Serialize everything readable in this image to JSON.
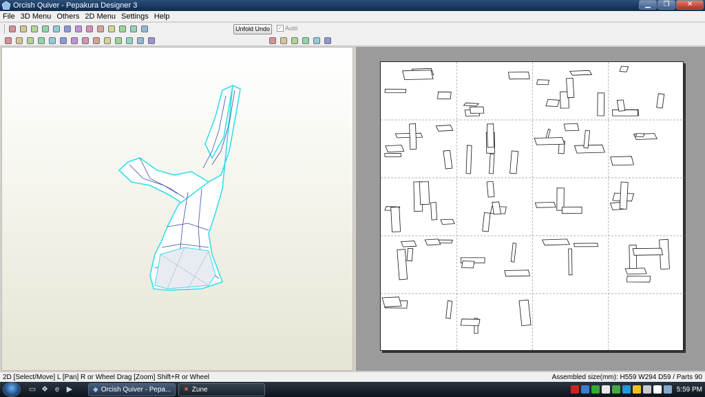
{
  "window": {
    "title": "Orcish Quiver - Pepakura Designer 3"
  },
  "window_controls": {
    "minimize": "▁",
    "maximize": "❐",
    "close": "✕"
  },
  "menu": [
    "File",
    "3D Menu",
    "Others",
    "2D Menu",
    "Settings",
    "Help"
  ],
  "toolbar": {
    "undo_label": "Unfold Undo",
    "auto_label": "Auto",
    "auto_checked": true
  },
  "toolbar1_icons": [
    "open-folder-icon",
    "save-icon",
    "bulb-icon",
    "cube-color-icon",
    "rotate-icon",
    "move-icon",
    "pencil-icon",
    "cylinder-icon",
    "anchor-icon",
    "page-icon",
    "globe-icon",
    "window-icon",
    "window2-icon"
  ],
  "toolbar2_icons": [
    "select-icon",
    "pen-icon",
    "part-icon",
    "flip-icon",
    "flap-icon",
    "edge-icon",
    "fill-icon",
    "paint-icon",
    "back-icon",
    "group-icon",
    "join-icon",
    "split-icon",
    "print-icon",
    "grid-icon"
  ],
  "toolbar2_right_icons": [
    "align-left-icon",
    "align-center-icon",
    "align-top-icon",
    "align-bottom-icon",
    "rotate-left-icon",
    "rotate-right-icon"
  ],
  "statusbar": {
    "left": "2D [Select/Move] L [Pan] R or Wheel Drag [Zoom] Shift+R or Wheel",
    "right": "Assembled size(mm): H559 W294 D59 / Parts 90"
  },
  "taskbar": {
    "tasks": [
      "Orcish Quiver - Pepa...",
      "Zune"
    ],
    "clock": "5:59 PM",
    "tray_colors": [
      "#cc2222",
      "#3a7bd5",
      "#33aa33",
      "#e8e8e8",
      "#44aa44",
      "#2299dd",
      "#f0c020",
      "#cccccc",
      "#ffffff",
      "#88aacc"
    ]
  },
  "colors": {
    "model_edge": "#33dde8",
    "model_fold": "#1a2a9a",
    "paper_border": "#222222"
  }
}
